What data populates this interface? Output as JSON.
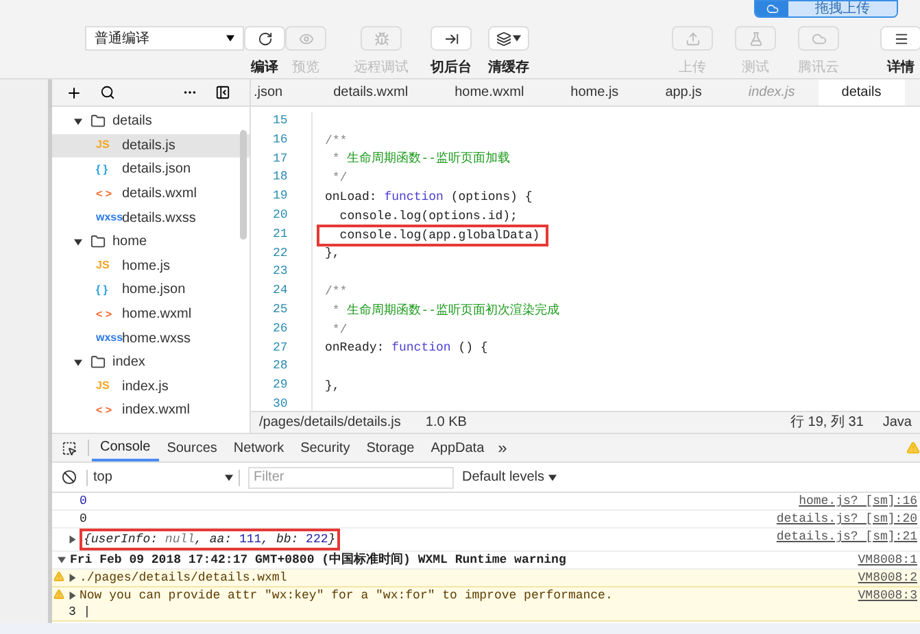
{
  "upload_button": {
    "label": "拖拽上传"
  },
  "toolbar": {
    "compile_mode": "普通编译",
    "buttons": [
      {
        "kind": "refresh",
        "label": "编译",
        "disabled": false
      },
      {
        "kind": "eye",
        "label": "预览",
        "disabled": true
      },
      {
        "kind": "bug",
        "label": "远程调试",
        "disabled": true
      },
      {
        "kind": "background",
        "label": "切后台",
        "disabled": false
      },
      {
        "kind": "layers",
        "label": "清缓存",
        "disabled": false
      },
      {
        "kind": "upload",
        "label": "上传",
        "disabled": true
      },
      {
        "kind": "flask",
        "label": "测试",
        "disabled": true
      },
      {
        "kind": "cloud",
        "label": "腾讯云",
        "disabled": true
      },
      {
        "kind": "menu",
        "label": "详情",
        "disabled": false
      }
    ]
  },
  "file_tree": {
    "items": [
      {
        "kind": "folder",
        "name": "details",
        "expanded": true,
        "children": [
          {
            "kind": "js",
            "badge": "JS",
            "name": "details.js",
            "selected": true
          },
          {
            "kind": "json",
            "badge": "{ }",
            "name": "details.json",
            "selected": false
          },
          {
            "kind": "wxml",
            "badge": "< >",
            "name": "details.wxml",
            "selected": false
          },
          {
            "kind": "wxss",
            "badge": "wxss",
            "name": "details.wxss",
            "selected": false
          }
        ]
      },
      {
        "kind": "folder",
        "name": "home",
        "expanded": true,
        "children": [
          {
            "kind": "js",
            "badge": "JS",
            "name": "home.js",
            "selected": false
          },
          {
            "kind": "json",
            "badge": "{ }",
            "name": "home.json",
            "selected": false
          },
          {
            "kind": "wxml",
            "badge": "< >",
            "name": "home.wxml",
            "selected": false
          },
          {
            "kind": "wxss",
            "badge": "wxss",
            "name": "home.wxss",
            "selected": false
          }
        ]
      },
      {
        "kind": "folder",
        "name": "index",
        "expanded": true,
        "children": [
          {
            "kind": "js",
            "badge": "JS",
            "name": "index.js",
            "selected": false
          },
          {
            "kind": "wxml",
            "badge": "< >",
            "name": "index.wxml",
            "selected": false
          }
        ]
      }
    ]
  },
  "editor": {
    "tabs": [
      {
        "label": ".json",
        "selected": false,
        "italic": false
      },
      {
        "label": "details.wxml",
        "selected": false,
        "italic": false
      },
      {
        "label": "home.wxml",
        "selected": false,
        "italic": false
      },
      {
        "label": "home.js",
        "selected": false,
        "italic": false
      },
      {
        "label": "app.js",
        "selected": false,
        "italic": false
      },
      {
        "label": "index.js",
        "selected": false,
        "italic": true
      },
      {
        "label": "details",
        "selected": true,
        "italic": false
      }
    ],
    "lines": [
      {
        "number": "15"
      },
      {
        "number": "16",
        "tokens": [
          {
            "kind": "mark",
            "text": "/**"
          }
        ]
      },
      {
        "number": "17",
        "tokens": [
          {
            "kind": "mark",
            "text": " * "
          },
          {
            "kind": "comment",
            "text": "生命周期函数--监听页面加载"
          }
        ]
      },
      {
        "number": "18",
        "tokens": [
          {
            "kind": "mark",
            "text": " */"
          }
        ]
      },
      {
        "number": "19",
        "tokens": [
          {
            "kind": "plain",
            "text": "onLoad: "
          },
          {
            "kind": "keyword",
            "text": "function"
          },
          {
            "kind": "plain",
            "text": " (options) {"
          }
        ]
      },
      {
        "number": "20",
        "tokens": [
          {
            "kind": "plain",
            "text": "  console.log(options.id);"
          }
        ]
      },
      {
        "number": "21",
        "highlighted": true,
        "tokens": [
          {
            "kind": "plain",
            "text": "  console.log(app.globalData)"
          }
        ]
      },
      {
        "number": "22",
        "tokens": [
          {
            "kind": "plain",
            "text": "},"
          }
        ]
      },
      {
        "number": "23"
      },
      {
        "number": "24",
        "tokens": [
          {
            "kind": "mark",
            "text": "/**"
          }
        ]
      },
      {
        "number": "25",
        "tokens": [
          {
            "kind": "mark",
            "text": " * "
          },
          {
            "kind": "comment",
            "text": "生命周期函数--监听页面初次渲染完成"
          }
        ]
      },
      {
        "number": "26",
        "tokens": [
          {
            "kind": "mark",
            "text": " */"
          }
        ]
      },
      {
        "number": "27",
        "tokens": [
          {
            "kind": "plain",
            "text": "onReady: "
          },
          {
            "kind": "keyword",
            "text": "function"
          },
          {
            "kind": "plain",
            "text": " () {"
          }
        ]
      },
      {
        "number": "28"
      },
      {
        "number": "29",
        "tokens": [
          {
            "kind": "plain",
            "text": "},"
          }
        ]
      },
      {
        "number": "30"
      }
    ],
    "status_bar": {
      "path": "/pages/details/details.js",
      "size": "1.0 KB",
      "cursor": "行 19, 列 31",
      "language": "Java"
    }
  },
  "devtools": {
    "tabs": [
      {
        "label": "Console",
        "selected": true
      },
      {
        "label": "Sources",
        "selected": false
      },
      {
        "label": "Network",
        "selected": false
      },
      {
        "label": "Security",
        "selected": false
      },
      {
        "label": "Storage",
        "selected": false
      },
      {
        "label": "AppData",
        "selected": false
      }
    ],
    "more": "»",
    "context": "top",
    "filter_placeholder": "Filter",
    "levels": "Default levels",
    "messages": [
      {
        "kind": "log",
        "parts": [
          {
            "kind": "number",
            "text": "0"
          }
        ],
        "source": "home.js? [sm]:16"
      },
      {
        "kind": "log",
        "parts": [
          {
            "kind": "plain",
            "text": "0"
          }
        ],
        "source": "details.js? [sm]:20"
      },
      {
        "kind": "object",
        "highlighted": true,
        "parts": [
          {
            "kind": "plain",
            "text": "{userInfo: "
          },
          {
            "kind": "null",
            "text": "null"
          },
          {
            "kind": "plain",
            "text": ", aa: "
          },
          {
            "kind": "number",
            "text": "111"
          },
          {
            "kind": "plain",
            "text": ", bb: "
          },
          {
            "kind": "number",
            "text": "222"
          },
          {
            "kind": "plain",
            "text": "}"
          }
        ],
        "source": "details.js? [sm]:21"
      },
      {
        "kind": "group",
        "parts": [
          {
            "kind": "plain",
            "text": "Fri Feb 09 2018 17:42:17 GMT+0800 (中国标准时间) WXML Runtime warning"
          }
        ],
        "source": "VM8008:1"
      },
      {
        "kind": "warning",
        "parts": [
          {
            "kind": "plain",
            "text": "./pages/details/details.wxml"
          }
        ],
        "source": "VM8008:2"
      },
      {
        "kind": "warning",
        "parts": [
          {
            "kind": "plain",
            "text": "Now you can provide attr \"wx:key\" for a \"wx:for\" to improve performance."
          }
        ],
        "extra": "3 |",
        "source": "VM8008:3"
      }
    ]
  }
}
